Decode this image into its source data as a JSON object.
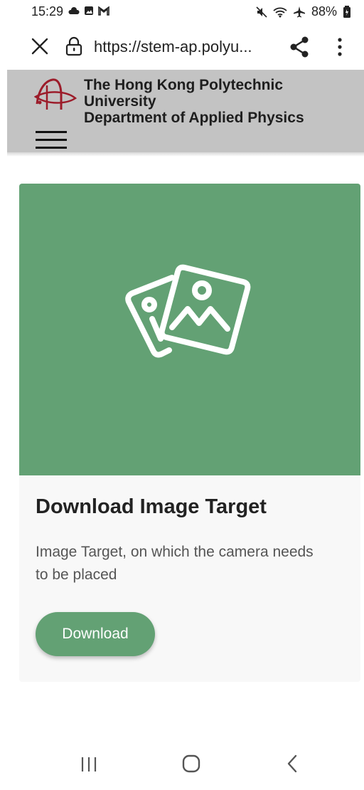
{
  "status": {
    "time": "15:29",
    "battery": "88%"
  },
  "browser": {
    "url": "https://stem-ap.polyu...",
    "icons": [
      "close-icon",
      "lock-icon",
      "share-icon",
      "more-vert-icon"
    ]
  },
  "header": {
    "line1": "The Hong Kong Polytechnic",
    "line2": "University",
    "line3": "Department of Applied Physics",
    "background": "#c3c3c3"
  },
  "card": {
    "title": "Download Image Target",
    "description": "Image Target, on which the camera needs to be placed",
    "button_label": "Download",
    "accent": "#63a174",
    "icon": "image-gallery-icon"
  },
  "nav": {
    "icons": [
      "recent-apps-icon",
      "home-icon",
      "back-icon"
    ]
  }
}
